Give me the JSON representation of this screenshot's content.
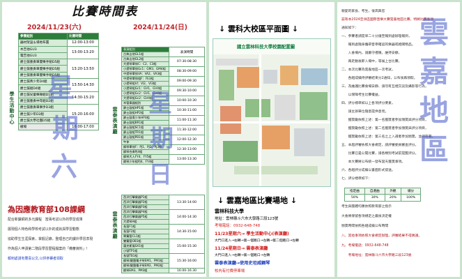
{
  "left": {
    "title": "比賽時間表",
    "day1": "2024/11/23(六)",
    "day2": "2024/11/24(日)",
    "col_event": "參賽組別",
    "col_time": "比賽時間",
    "watermark1": "星",
    "watermark2": "期",
    "watermark3": "六",
    "watermark4": "星",
    "watermark5": "期",
    "watermark6": "日",
    "side_label_1": "學生活動中心",
    "side_label_2": "雲泰表演廳",
    "side_label_3": "雲泰表演廳",
    "day1_events": [
      "器材架設＆場地布置",
      "木吉他GU3",
      "電吉他GU3",
      "爵士鼓重奏單雙樂手組D5組",
      "爵士鼓重奏單雙樂手組D5組",
      "爵士鼓重奏單雙樂手組D5組",
      "爵士鼓青少年D4組",
      "爵士鼓組D4組",
      "爵士鼓兒童樂隊組D1組",
      "爵士鼓重奏中年組D2組",
      "爵士鼓重奏單樂手D3組",
      "爵士鼓少年D2組",
      "爵士鼓大學社團D5組",
      "撤場"
    ],
    "day1_times": [
      "12:00-13:00",
      "13:00-13:20",
      "13:20-13:50",
      "13:50-14:30",
      "14:30-15:20",
      "15:20-16:00",
      "16:00-17:00"
    ],
    "day2_events": [
      "表演組別",
      "古典吉他GL1組",
      "古典吉他GL2組",
      "大提琴單排C：C2、C3組",
      "小提琴單排Gc1：GM3、GM4組",
      "中提琴單排VA：VA2、VA3組",
      "中提琴單排組F：FE3組",
      "小提琴組VI：VI2、VI3組",
      "小提琴組Gc1：GV1、GV4組",
      "小提琴組Gc2：GV1、GV4組",
      "大提琴組Gc2：GV4組",
      "木管樂器組別",
      "爵士鼓組HP1組",
      "爵士鼓組HP2組",
      "爵士鼓青少年HP3組",
      "爵士鼓組BR1組",
      "爵士鼓組SC1組",
      "爵士鼓組TR1組",
      "爵士鼓組PB1組",
      "午休",
      "鋼琴單排F：PJ1、PJ2、PJ3組",
      "鋼琴合奏PJ4組",
      "鋼琴大人FY4、FY5組",
      "鋼琴少年組PJ4、FY4組"
    ],
    "day2_times": [
      "表演時間",
      "07:30-08:30",
      "08:30-09:00",
      "09:00-09:30",
      "09:30-10:00",
      "10:00-10:30",
      "10:30-11:00",
      "11:00-11:30",
      "11:30-12:00",
      "12:00-12:30",
      "12:30-13:00",
      "13:00-13:30"
    ],
    "day2b_events": [
      "西洋打擊樂器P1組",
      "西洋打擊樂器P2組",
      "西洋打擊樂器P3組",
      "西洋打擊樂器P4組",
      "西洋打擊樂器P5組",
      "大提琴A組",
      "長笛F1組",
      "長笛F2組",
      "單簧管CL1組",
      "雙簧管OB1組",
      "薩克斯風SX1組",
      "小號TP1組",
      "長號TB1組",
      "鋼琴/鍵盤電子琴EM1、PM1組",
      "鋼琴/鍵盤電子琴EM2、PM2組",
      "鋼琴EM3、PM3組"
    ],
    "day2b_times": [
      "13:30-14:00",
      "14:00-14:30",
      "14:30-15:00",
      "15:00-15:30",
      "15:30-16:00",
      "16:00-16:30"
    ],
    "policy_title": "為因應教育部108課綱",
    "policy_lines": [
      "配合新課綱的多元課程　當兩考試以外的學習成果",
      "展現個人特色和學校考試以外的成就與學習動態",
      "協助學生生涯探索，掌握記錄，整理自己的課外學習表現",
      "作為個人申請第二階段學習歷程檔案的「備審資料」！",
      "報到處請有豐喜公文,以供參賽者領取"
    ]
  },
  "middle": {
    "map_title": "↓ 雲科大校區平面圖 ↓",
    "map_banner": "國立雲林科技大學校園配置圖",
    "venue_title": "↓ 雲嘉地區比賽場地 ↓",
    "school": "雲林科技大學",
    "address": "地址：雲林縣斗六市大學路三段123號",
    "phone": "考場電話：0932-648-748",
    "sat_line": "11/23星期六→ 學生活動中心(表演廳)",
    "sat_route": "大門口進入→右轉→第一個路口→左轉→第二個路口→左轉",
    "sun_line": "11/24星期日→ 雲泰表演廳",
    "sun_route": "大門口進入→右轉→第一個路口→左轉",
    "sun_line2": "雲泰表演廳→使用史坦威鋼琴",
    "parking": "校內有付費停車場"
  },
  "right": {
    "greeting": "親愛的家長、考生，很高興您",
    "lines": [
      "茲有本2024亞洲區國際音樂大賽雲嘉地區比賽，特將比賽事項",
      "通知如下：",
      "一、參賽者請提早二十分鐘至報到處辦理報到，",
      "　　報到處隨身攜帶音準確認的樂器或相關物品。",
      "　　入會場內，請嚴守禮儀，維持安靜，",
      "　　再走動後即入場中，等候上台比賽。",
      "二、本次比賽為雲嘉地區一次考試，",
      "　　各組成績待評審結束分2通知，公布後再領取。",
      "三、為維護比賽會場安靜、請勿有互相交談及攝影等行為，",
      "　　以保障考生比賽權益。",
      "四、評分標準如以上各項評分要素，",
      "　　請主辦單位隨意提供意見。",
      "　　獲獎勵依照上述：第一名獲獎者參加頒獎與評分項目，",
      "　　獲獎勵依照上述：第二名獲獎者參加頒獎與評分項目，",
      "　　獲獎勵依照上述：第三名之上入選者參加頒獎，並請帶著。",
      "五、本屆評審依照大會規定，請評審委員審查評分。",
      "　　比賽已是公開比賽，請各類別考試前提醒評分。",
      "　　本大賽將公布統一發布當天獲獎事項。",
      "六、各組評分成績以書面形式發送。",
      "七、評分標準如下："
    ],
    "score_headers": [
      "指定曲",
      "自選曲",
      "外觀",
      "總分"
    ],
    "score_values": [
      "50%",
      "30%",
      "20%",
      "100%"
    ],
    "bottom_lines": [
      "考生與團體均應依照教育部之指示",
      "大會將保留各項規定之最後決定權",
      "頒獎時間依照各組成績公布時間",
      "八、其他事項依照大會規定辦理，評審結果不得異議。",
      "九、考場電話：0932-648-748",
      "　　考場地址：雲林縣斗六市大學路三段123號"
    ],
    "wm1": "雲",
    "wm2": "嘉",
    "wm3": "地",
    "wm4": "區"
  }
}
